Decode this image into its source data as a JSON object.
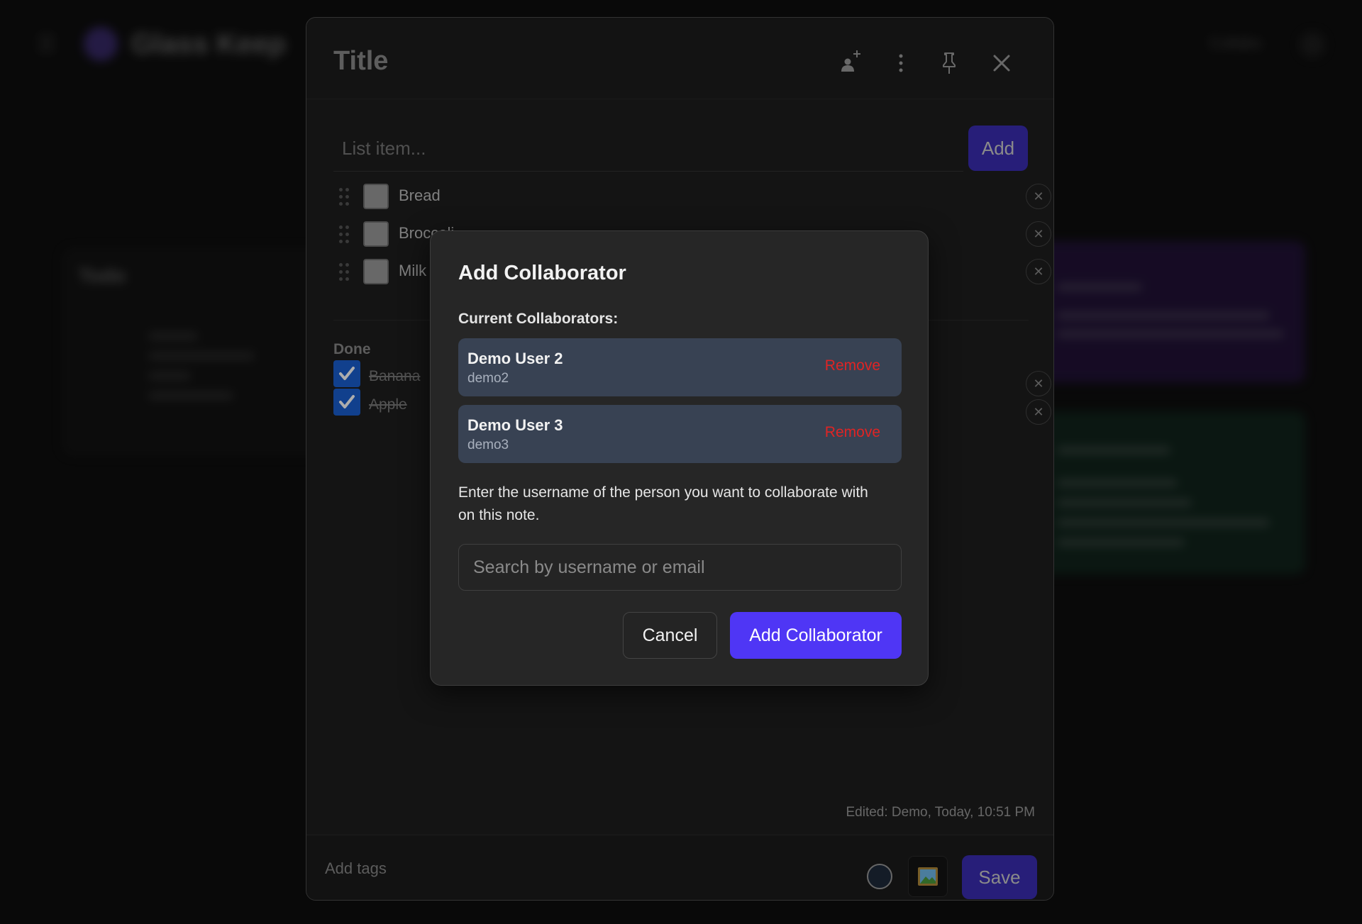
{
  "background": {
    "brand": "Glass Keep",
    "user_label": "Collabs",
    "card_title": "Todo"
  },
  "editor": {
    "title": "Title",
    "icons": [
      "add-collaborator-icon",
      "more-vertical-icon",
      "pin-icon",
      "close-icon"
    ],
    "list_input_placeholder": "List item...",
    "add_label": "Add",
    "items": [
      {
        "text": "Bread",
        "checked": false
      },
      {
        "text": "Broccoli",
        "checked": false
      },
      {
        "text": "Milk",
        "checked": false
      }
    ],
    "done_label": "Done",
    "done_items": [
      {
        "text": "Banana",
        "checked": true
      },
      {
        "text": "Apple",
        "checked": true
      }
    ],
    "edited": "Edited: Demo, Today, 10:51 PM",
    "tags_placeholder": "Add tags",
    "save_label": "Save"
  },
  "modal": {
    "title": "Add Collaborator",
    "current_label": "Current Collaborators:",
    "collaborators": [
      {
        "name": "Demo User 2",
        "username": "demo2",
        "remove_label": "Remove"
      },
      {
        "name": "Demo User 3",
        "username": "demo3",
        "remove_label": "Remove"
      }
    ],
    "description": "Enter the username of the person you want to collaborate with on this note.",
    "search_placeholder": "Search by username or email",
    "cancel_label": "Cancel",
    "submit_label": "Add Collaborator"
  },
  "colors": {
    "accent": "#4f36f5",
    "accent_dim": "#3a2db3",
    "danger": "#e02424",
    "collab_card": "#384253",
    "checkbox_checked": "#1a5fd0"
  }
}
